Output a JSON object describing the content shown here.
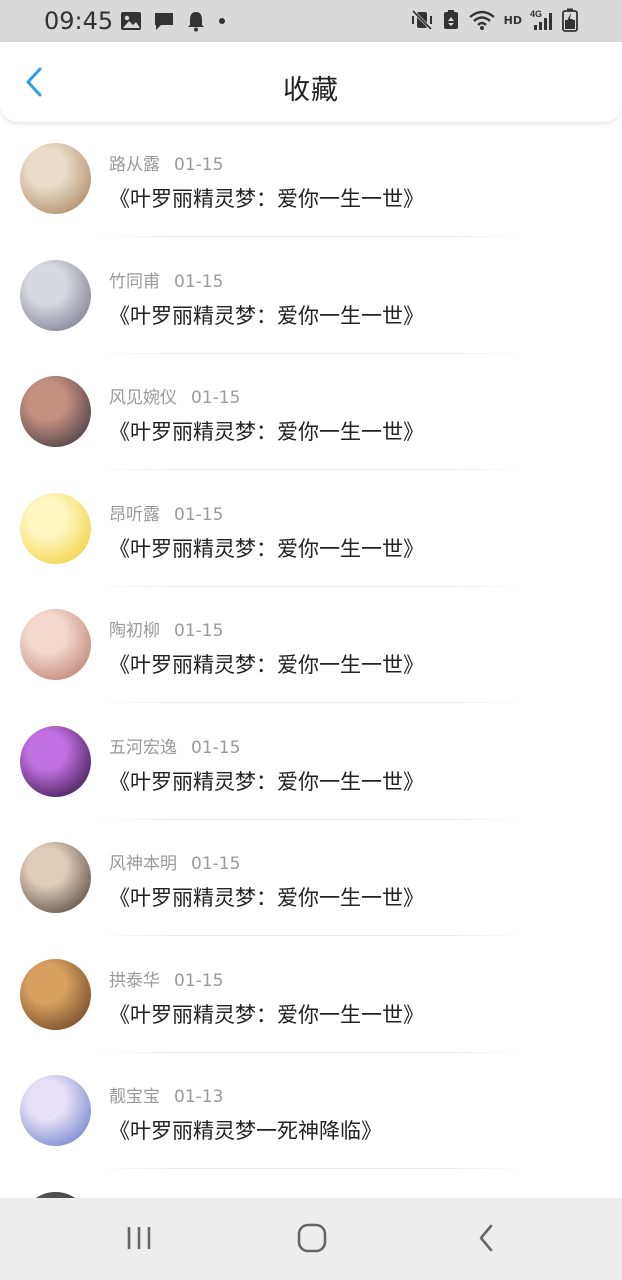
{
  "status_bar": {
    "time": "09:45",
    "left_icons": [
      "image-icon",
      "chat-icon",
      "bell-icon",
      "dot-icon"
    ],
    "right_icons": [
      "mute-vibrate-icon",
      "battery-saver-icon",
      "wifi-icon",
      "hd-icon",
      "signal-4g-icon",
      "battery-charging-icon"
    ],
    "hd_label": "HD"
  },
  "header": {
    "title": "收藏",
    "back_icon": "chevron-left-icon",
    "accent_color": "#2a9fe6"
  },
  "favorites": [
    {
      "user": "路从露",
      "date": "01-15",
      "title": "《叶罗丽精灵梦：爱你一生一世》",
      "avatar_colors": [
        "#e9dcc8",
        "#a07850"
      ]
    },
    {
      "user": "竹同甫",
      "date": "01-15",
      "title": "《叶罗丽精灵梦：爱你一生一世》",
      "avatar_colors": [
        "#d8d8e0",
        "#6a6a80"
      ]
    },
    {
      "user": "风见婉仪",
      "date": "01-15",
      "title": "《叶罗丽精灵梦：爱你一生一世》",
      "avatar_colors": [
        "#c49080",
        "#2a2a3a"
      ]
    },
    {
      "user": "昂听露",
      "date": "01-15",
      "title": "《叶罗丽精灵梦：爱你一生一世》",
      "avatar_colors": [
        "#fff6c0",
        "#f0c828"
      ]
    },
    {
      "user": "陶初柳",
      "date": "01-15",
      "title": "《叶罗丽精灵梦：爱你一生一世》",
      "avatar_colors": [
        "#f4d8cc",
        "#b07060"
      ]
    },
    {
      "user": "五河宏逸",
      "date": "01-15",
      "title": "《叶罗丽精灵梦：爱你一生一世》",
      "avatar_colors": [
        "#c070e0",
        "#200830"
      ]
    },
    {
      "user": "风神本明",
      "date": "01-15",
      "title": "《叶罗丽精灵梦：爱你一生一世》",
      "avatar_colors": [
        "#e0ccb8",
        "#3a3028"
      ]
    },
    {
      "user": "拱泰华",
      "date": "01-15",
      "title": "《叶罗丽精灵梦：爱你一生一世》",
      "avatar_colors": [
        "#d8a060",
        "#5a3418"
      ]
    },
    {
      "user": "靓宝宝",
      "date": "01-13",
      "title": "《叶罗丽精灵梦一死神降临》",
      "avatar_colors": [
        "#e8e0f8",
        "#5870c0"
      ]
    },
    {
      "user": "",
      "date": "",
      "title": "",
      "avatar_colors": [
        "#555555",
        "#222222"
      ]
    }
  ],
  "nav_bar": {
    "recents_icon": "recents-icon",
    "home_icon": "home-icon",
    "back_icon": "back-icon"
  }
}
